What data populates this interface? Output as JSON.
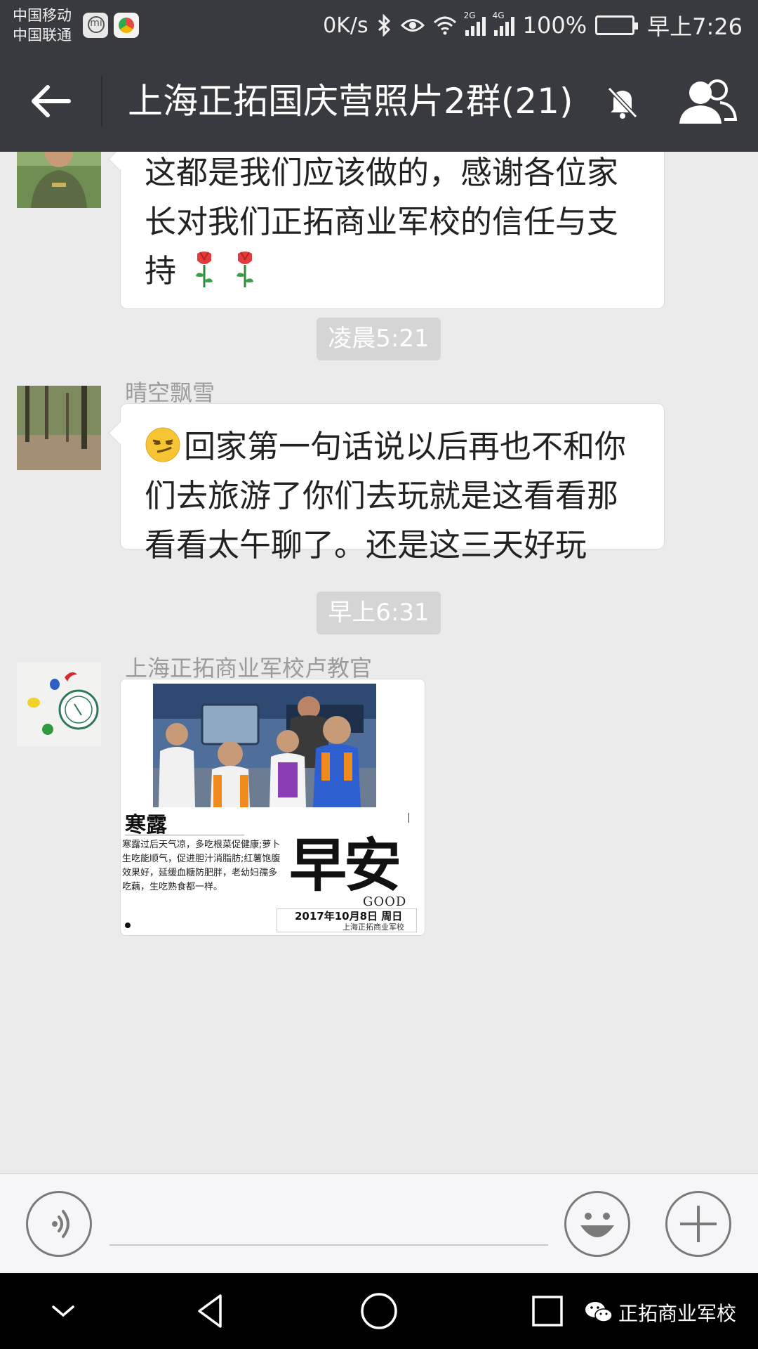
{
  "status_bar": {
    "carrier_1": "中国移动",
    "carrier_2": "中国联通",
    "net_speed": "0K/s",
    "sig1_label": "2G",
    "sig2_label": "4G",
    "battery": "100%",
    "time": "早上7:26"
  },
  "header": {
    "title": "上海正拓国庆营照片2群(21)",
    "icons": [
      "back-arrow-icon",
      "bell-mute-icon",
      "group-members-icon"
    ]
  },
  "messages": [
    {
      "sender": "",
      "text": "这都是我们应该做的，感谢各位家长对我们正拓商业军校的信任与支持",
      "emoji": [
        "rose",
        "rose"
      ]
    },
    {
      "time_separator": "凌晨5:21"
    },
    {
      "sender": "晴空飘雪",
      "emoji_prefix": "smirk",
      "text": "回家第一句话说以后再也不和你们去旅游了你们去玩就是这看看那看看太午聊了。还是这三天好玩"
    },
    {
      "time_separator": "早上6:31"
    },
    {
      "sender": "上海正拓商业军校卢教官",
      "image": {
        "title": "寒露",
        "text": "寒露过后天气凉，多吃根菜促健康;萝卜生吃能顺气，促进胆汁消脂肪;红薯饱腹效果好，延缓血糖防肥胖，老幼妇孺多吃藕，生吃熟食都一样。",
        "big_text": "早安",
        "good": "GOOD",
        "date": "2017年10月8日 周日",
        "school": "上海正拓商业军校"
      }
    }
  ],
  "input_bar": {
    "value": "",
    "icons": [
      "voice-icon",
      "emoji-icon",
      "plus-icon"
    ]
  },
  "nav_bar": {
    "icons": [
      "chevron-down-icon",
      "back-triangle-icon",
      "home-circle-icon",
      "recents-square-icon"
    ],
    "watermark": "正拓商业军校"
  },
  "colors": {
    "header_bg": "#393a3f",
    "chat_bg": "#ebebeb",
    "bubble_bg": "#ffffff",
    "time_pill": "#d5d5d5"
  }
}
